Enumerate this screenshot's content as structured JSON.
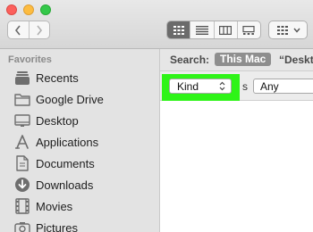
{
  "toolbar": {
    "traffic_lights": [
      "close",
      "minimize",
      "zoom"
    ],
    "nav": [
      "back",
      "forward"
    ],
    "view_modes": [
      {
        "name": "icon-view",
        "active": true
      },
      {
        "name": "list-view",
        "active": false
      },
      {
        "name": "column-view",
        "active": false
      },
      {
        "name": "gallery-view",
        "active": false
      }
    ],
    "arrange_icon": "arrange-grid-icon"
  },
  "sidebar": {
    "header": "Favorites",
    "items": [
      {
        "label": "Recents",
        "icon": "clock-stack-icon"
      },
      {
        "label": "Google Drive",
        "icon": "folder-icon"
      },
      {
        "label": "Desktop",
        "icon": "desktop-folder-icon"
      },
      {
        "label": "Applications",
        "icon": "applications-icon"
      },
      {
        "label": "Documents",
        "icon": "document-icon"
      },
      {
        "label": "Downloads",
        "icon": "download-icon"
      },
      {
        "label": "Movies",
        "icon": "film-icon"
      },
      {
        "label": "Pictures",
        "icon": "camera-icon"
      }
    ]
  },
  "search": {
    "label": "Search:",
    "scope_active": "This Mac",
    "scope_other": "“Deskt"
  },
  "criteria": {
    "attribute": "Kind",
    "operator_partial": "s",
    "value": "Any",
    "highlight_color": "#2ef417"
  }
}
